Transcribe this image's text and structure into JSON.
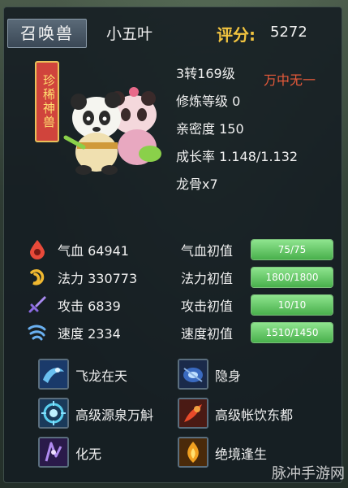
{
  "header": {
    "title": "召唤兽",
    "pet_name": "小五叶",
    "score_label": "评分:",
    "score_value": "5272"
  },
  "pet": {
    "seal_text": "珍稀神兽"
  },
  "info": {
    "level": "3转169级",
    "rank": "万中无一",
    "cultivation": "修炼等级 0",
    "intimacy": "亲密度 150",
    "growth": "成长率 1.148/1.132",
    "dragon_bone": "龙骨x7"
  },
  "stats": [
    {
      "icon": "blood-drop-icon",
      "label": "气血 64941",
      "base_label": "气血初值",
      "base_value": "75/75",
      "fill": 1.0
    },
    {
      "icon": "mana-swirl-icon",
      "label": "法力 330773",
      "base_label": "法力初值",
      "base_value": "1800/1800",
      "fill": 1.0
    },
    {
      "icon": "sword-icon",
      "label": "攻击 6839",
      "base_label": "攻击初值",
      "base_value": "10/10",
      "fill": 1.0
    },
    {
      "icon": "wind-speed-icon",
      "label": "速度 2334",
      "base_label": "速度初值",
      "base_value": "1510/1450",
      "fill": 1.0
    }
  ],
  "skills": [
    {
      "icon": "flying-dragon-skill-icon",
      "label": "飞龙在天"
    },
    {
      "icon": "stealth-skill-icon",
      "label": "隐身"
    },
    {
      "icon": "spring-skill-icon",
      "label": "高级源泉万斛"
    },
    {
      "icon": "drink-skill-icon",
      "label": "高级帐饮东都"
    },
    {
      "icon": "transform-skill-icon",
      "label": "化无"
    },
    {
      "icon": "phoenix-skill-icon",
      "label": "绝境逢生"
    }
  ],
  "watermark": "脉冲手游网",
  "colors": {
    "accent_gold": "#f2c440",
    "rank_red": "#e85a3a",
    "bar_green": "#49b04c"
  }
}
